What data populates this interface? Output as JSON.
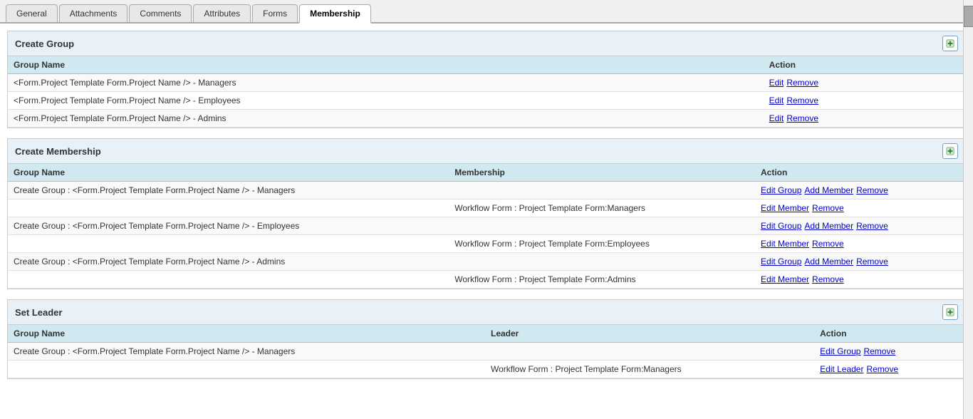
{
  "tabs": [
    {
      "label": "General",
      "active": false
    },
    {
      "label": "Attachments",
      "active": false
    },
    {
      "label": "Comments",
      "active": false
    },
    {
      "label": "Attributes",
      "active": false
    },
    {
      "label": "Forms",
      "active": false
    },
    {
      "label": "Membership",
      "active": true
    }
  ],
  "sections": {
    "createGroup": {
      "title": "Create Group",
      "columns": [
        "Group Name",
        "Action"
      ],
      "rows": [
        {
          "groupName": "<Form.Project Template Form.Project Name /> - Managers",
          "actions": [
            {
              "label": "Edit",
              "name": "edit-link"
            },
            {
              "label": "Remove",
              "name": "remove-link"
            }
          ]
        },
        {
          "groupName": "<Form.Project Template Form.Project Name /> - Employees",
          "actions": [
            {
              "label": "Edit",
              "name": "edit-link"
            },
            {
              "label": "Remove",
              "name": "remove-link"
            }
          ]
        },
        {
          "groupName": "<Form.Project Template Form.Project Name /> - Admins",
          "actions": [
            {
              "label": "Edit",
              "name": "edit-link"
            },
            {
              "label": "Remove",
              "name": "remove-link"
            }
          ]
        }
      ]
    },
    "createMembership": {
      "title": "Create Membership",
      "columns": [
        "Group Name",
        "Membership",
        "Action"
      ],
      "rows": [
        {
          "groupName": "Create Group : <Form.Project Template Form.Project Name /> - Managers",
          "membership": "",
          "actions": [
            {
              "label": "Edit Group",
              "name": "edit-group-link"
            },
            {
              "label": "Add Member",
              "name": "add-member-link"
            },
            {
              "label": "Remove",
              "name": "remove-link"
            }
          ]
        },
        {
          "groupName": "",
          "membership": "Workflow Form : Project Template Form:Managers",
          "actions": [
            {
              "label": "Edit Member",
              "name": "edit-member-link"
            },
            {
              "label": "Remove",
              "name": "remove-link"
            }
          ]
        },
        {
          "groupName": "Create Group : <Form.Project Template Form.Project Name /> - Employees",
          "membership": "",
          "actions": [
            {
              "label": "Edit Group",
              "name": "edit-group-link"
            },
            {
              "label": "Add Member",
              "name": "add-member-link"
            },
            {
              "label": "Remove",
              "name": "remove-link"
            }
          ]
        },
        {
          "groupName": "",
          "membership": "Workflow Form : Project Template Form:Employees",
          "actions": [
            {
              "label": "Edit Member",
              "name": "edit-member-link"
            },
            {
              "label": "Remove",
              "name": "remove-link"
            }
          ]
        },
        {
          "groupName": "Create Group : <Form.Project Template Form.Project Name /> - Admins",
          "membership": "",
          "actions": [
            {
              "label": "Edit Group",
              "name": "edit-group-link"
            },
            {
              "label": "Add Member",
              "name": "add-member-link"
            },
            {
              "label": "Remove",
              "name": "remove-link"
            }
          ]
        },
        {
          "groupName": "",
          "membership": "Workflow Form : Project Template Form:Admins",
          "actions": [
            {
              "label": "Edit Member",
              "name": "edit-member-link"
            },
            {
              "label": "Remove",
              "name": "remove-link"
            }
          ]
        }
      ]
    },
    "setLeader": {
      "title": "Set Leader",
      "columns": [
        "Group Name",
        "Leader",
        "Action"
      ],
      "rows": [
        {
          "groupName": "Create Group : <Form.Project Template Form.Project Name /> - Managers",
          "leader": "",
          "actions": [
            {
              "label": "Edit Group",
              "name": "edit-group-link"
            },
            {
              "label": "Remove",
              "name": "remove-link"
            }
          ]
        },
        {
          "groupName": "",
          "leader": "Workflow Form : Project Template Form:Managers",
          "actions": [
            {
              "label": "Edit Leader",
              "name": "edit-leader-link"
            },
            {
              "label": "Remove",
              "name": "remove-link"
            }
          ]
        }
      ]
    }
  }
}
